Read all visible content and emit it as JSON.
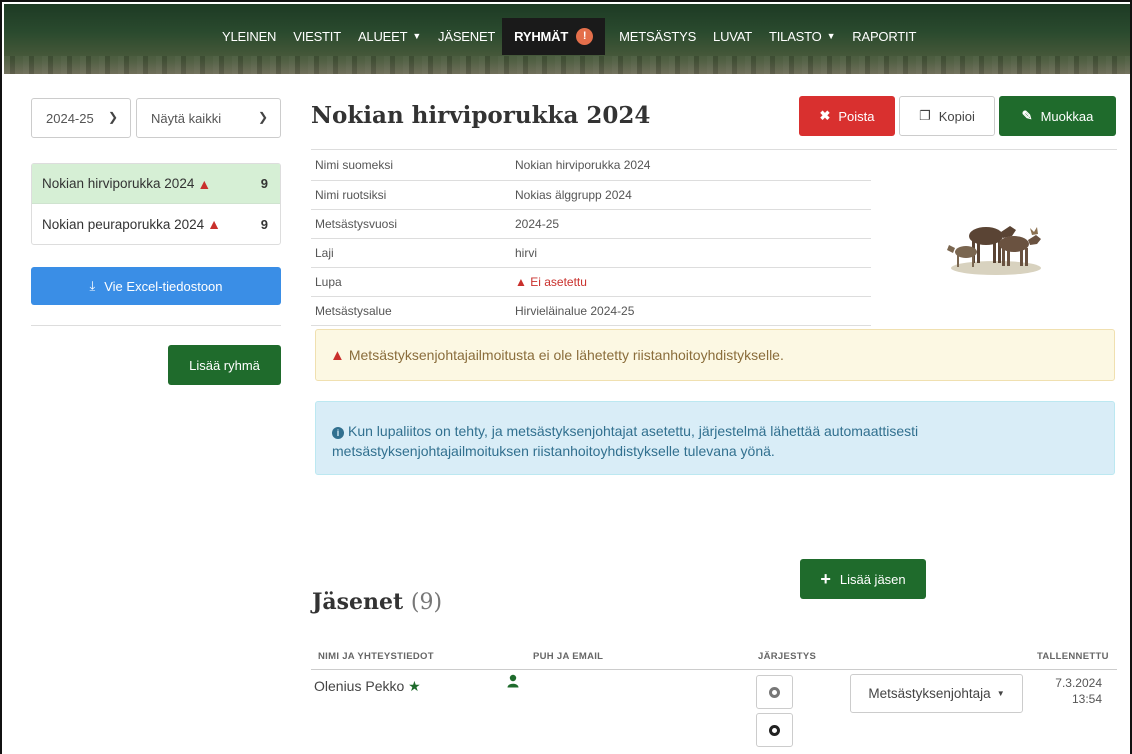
{
  "nav": {
    "items": [
      {
        "label": "YLEINEN"
      },
      {
        "label": "VIESTIT"
      },
      {
        "label": "ALUEET",
        "dropdown": true
      },
      {
        "label": "JÄSENET"
      },
      {
        "label": "RYHMÄT",
        "active": true,
        "alert": "!"
      },
      {
        "label": "METSÄSTYS"
      },
      {
        "label": "LUVAT"
      },
      {
        "label": "TILASTO",
        "dropdown": true
      },
      {
        "label": "RAPORTIT"
      }
    ]
  },
  "sidebar": {
    "year_select": "2024-25",
    "filter_select": "Näytä kaikki",
    "groups": [
      {
        "name": "Nokian hirviporukka 2024",
        "count": "9",
        "warning": true,
        "active": true
      },
      {
        "name": "Nokian peuraporukka 2024",
        "count": "9",
        "warning": true,
        "active": false
      }
    ],
    "export_label": "Vie Excel-tiedostoon",
    "add_group_label": "Lisää ryhmä"
  },
  "main": {
    "title": "Nokian hirviporukka 2024",
    "actions": {
      "delete": "Poista",
      "copy": "Kopioi",
      "edit": "Muokkaa"
    },
    "info": [
      {
        "key": "Nimi suomeksi",
        "value": "Nokian hirviporukka 2024"
      },
      {
        "key": "Nimi ruotsiksi",
        "value": "Nokias älggrupp 2024"
      },
      {
        "key": "Metsästysvuosi",
        "value": "2024-25"
      },
      {
        "key": "Laji",
        "value": "hirvi"
      },
      {
        "key": "Lupa",
        "value": "Ei asetettu"
      },
      {
        "key": "Metsästysalue",
        "value": "Hirvieläinalue 2024-25"
      }
    ],
    "warning_text": "Metsästyksenjohtajailmoitusta ei ole lähetetty riistanhoitoyhdistykselle.",
    "info_text": "Kun lupaliitos on tehty, ja metsästyksenjohtajat asetettu, järjestelmä lähettää automaattisesti metsästyksenjohtajailmoituksen riistanhoitoyhdistykselle tulevana yönä."
  },
  "members": {
    "add_label": "Lisää jäsen",
    "title": "Jäsenet",
    "count": "(9)",
    "columns": {
      "name": "NIMI JA YHTEYSTIEDOT",
      "contact": "PUH JA EMAIL",
      "order": "JÄRJESTYS",
      "saved": "TALLENNETTU"
    },
    "rows": [
      {
        "name": "Olenius Pekko",
        "role": "Metsästyksenjohtaja",
        "saved_date": "7.3.2024",
        "saved_time": "13:54"
      }
    ]
  },
  "colors": {
    "primary_green": "#1f6b2c",
    "danger": "#d9302f",
    "info_blue": "#3a8ee6"
  }
}
